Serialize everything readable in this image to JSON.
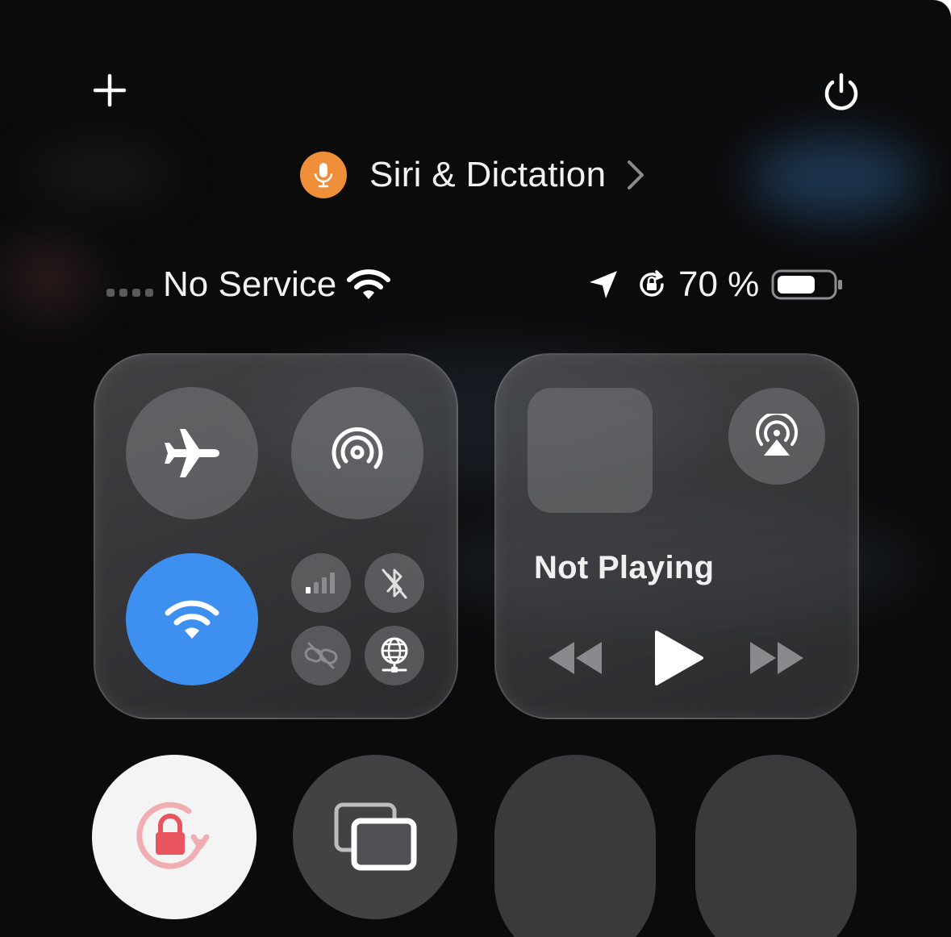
{
  "header": {
    "add_icon": "plus-icon",
    "power_icon": "power-icon"
  },
  "siri": {
    "label": "Siri & Dictation",
    "badge_icon": "microphone-icon",
    "badge_color": "#ef8f3a"
  },
  "status_bar": {
    "carrier": "No Service",
    "battery_percent": "70 %",
    "battery_level": 0.7
  },
  "connectivity": {
    "airplane_mode": false,
    "airdrop": false,
    "wifi": true,
    "wifi_color": "#3d8ff0",
    "cellular": false,
    "bluetooth": false,
    "personal_hotspot": false,
    "vpn": false
  },
  "media": {
    "status": "Not Playing"
  },
  "controls": {
    "orientation_lock": true,
    "orientation_lock_color": "#e8555e"
  }
}
